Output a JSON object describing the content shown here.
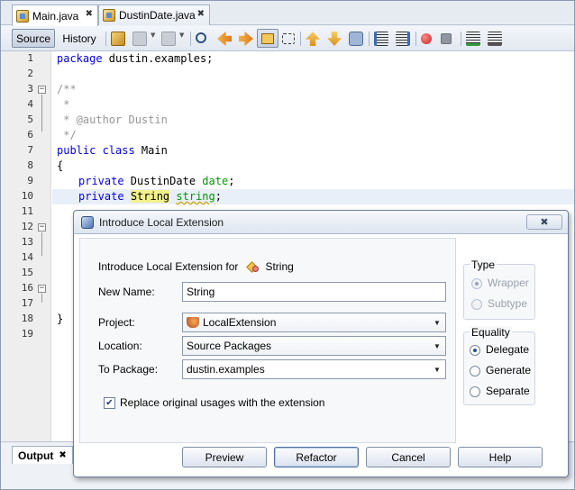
{
  "tabs": [
    {
      "label": "Main.java",
      "active": true
    },
    {
      "label": "DustinDate.java",
      "active": false
    }
  ],
  "toolbar": {
    "source_label": "Source",
    "history_label": "History"
  },
  "editor": {
    "line_numbers": [
      "1",
      "2",
      "3",
      "4",
      "5",
      "6",
      "7",
      "8",
      "9",
      "10",
      "11",
      "12",
      "13",
      "14",
      "15",
      "16",
      "17",
      "18",
      "19"
    ],
    "lines": {
      "l1_kw": "package",
      "l1_rest": " dustin.examples;",
      "l3": "/**",
      "l4": " *",
      "l5": " * @author Dustin",
      "l6": " */",
      "l7_kw": "public class",
      "l7_rest": " Main",
      "l8": "{",
      "l9_kw": "private",
      "l9_type": " DustinDate ",
      "l9_field": "date",
      "l9_end": ";",
      "l10_kw": "private",
      "l10_type": "String",
      "l10_field": "string",
      "l10_end": ";",
      "l18": "}"
    }
  },
  "output": {
    "tab_label": "Output"
  },
  "dialog": {
    "title": "Introduce Local Extension",
    "heading_prefix": "Introduce Local Extension for",
    "heading_class": "String",
    "new_name_label": "New Name:",
    "new_name_value": "String",
    "project_label": "Project:",
    "project_value": "LocalExtension",
    "location_label": "Location:",
    "location_value": "Source Packages",
    "package_label": "To Package:",
    "package_value": "dustin.examples",
    "replace_label": "Replace original usages with the extension",
    "replace_checked": true,
    "type_group": {
      "title": "Type",
      "options": [
        {
          "label": "Wrapper",
          "selected": true,
          "enabled": false
        },
        {
          "label": "Subtype",
          "selected": false,
          "enabled": false
        }
      ]
    },
    "equality_group": {
      "title": "Equality",
      "options": [
        {
          "label": "Delegate",
          "selected": true
        },
        {
          "label": "Generate",
          "selected": false
        },
        {
          "label": "Separate",
          "selected": false
        }
      ]
    },
    "buttons": {
      "preview": "Preview",
      "refactor": "Refactor",
      "cancel": "Cancel",
      "help": "Help"
    }
  }
}
